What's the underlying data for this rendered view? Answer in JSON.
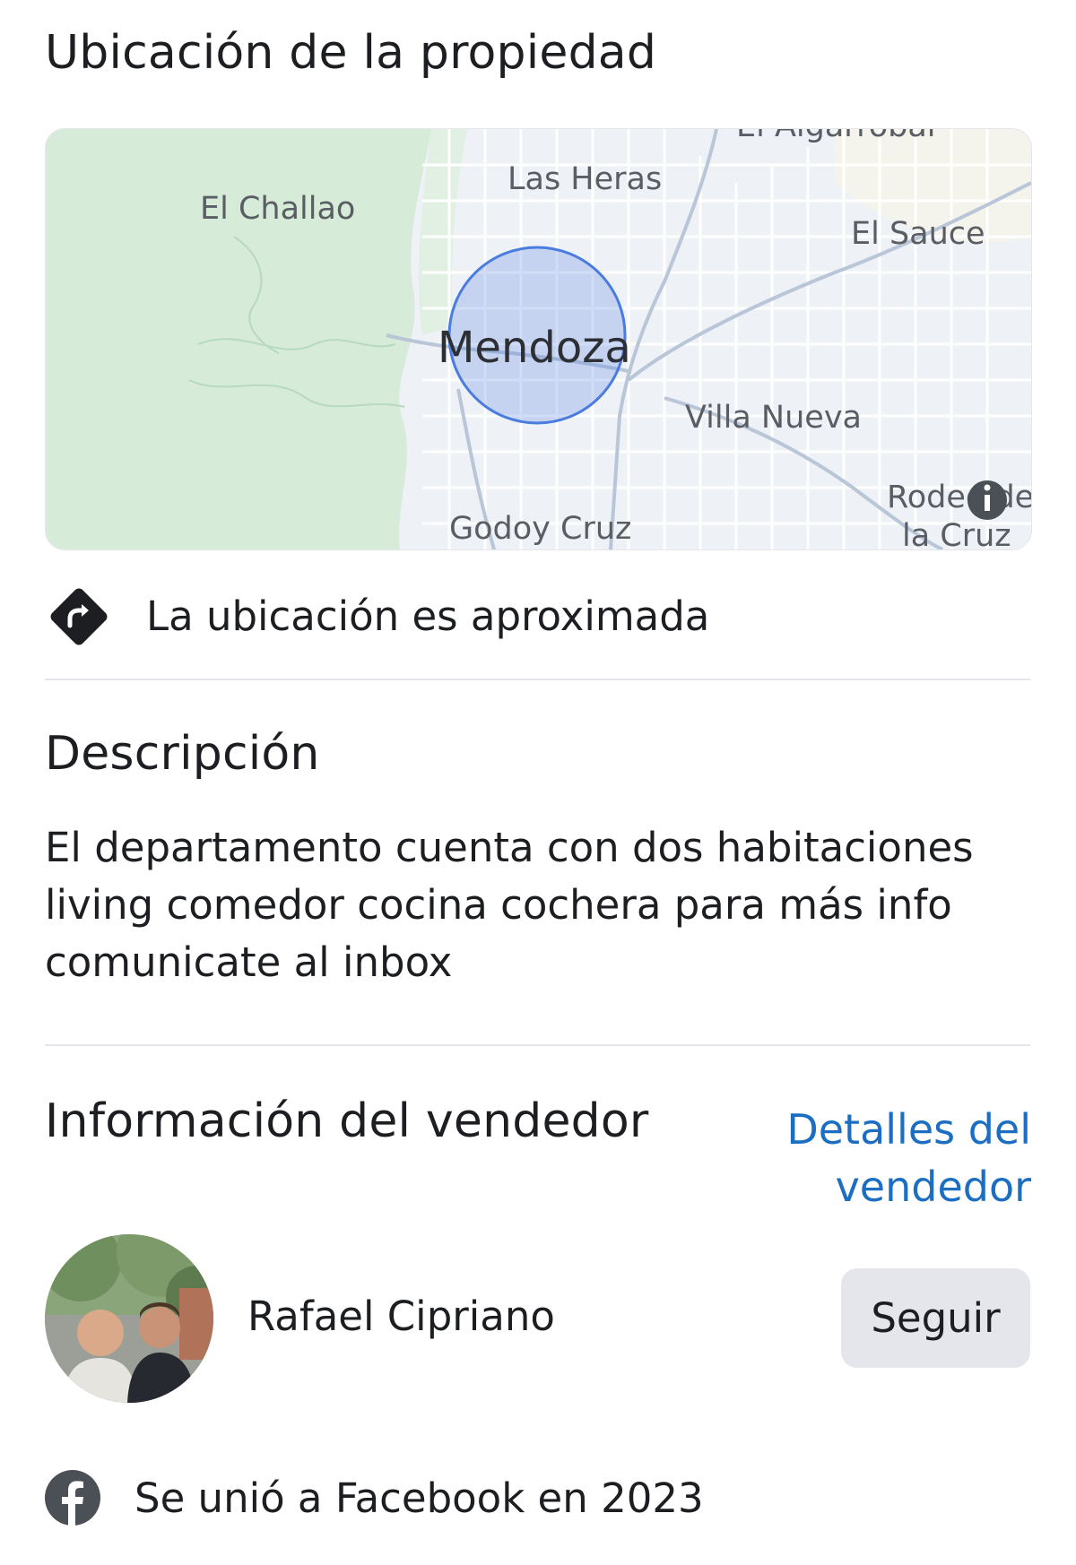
{
  "location": {
    "title": "Ubicación de la propiedad",
    "map_labels": {
      "top_cut": "El Algarrobal",
      "las_heras": "Las Heras",
      "el_challao": "El Challao",
      "el_sauce": "El Sauce",
      "mendoza": "Mendoza",
      "villa_nueva": "Villa Nueva",
      "rodeo_line1": "Rodeo de",
      "rodeo_line2": "la Cruz",
      "godoy_cruz": "Godoy Cruz"
    },
    "approx_note": "La ubicación es aproximada"
  },
  "description": {
    "title": "Descripción",
    "lines": [
      "El departamento cuenta con dos habitaciones",
      "living comedor cocina cochera para más info",
      "comunicate al inbox"
    ]
  },
  "seller": {
    "title": "Información del vendedor",
    "details_link_line1": "Detalles del",
    "details_link_line2": "vendedor",
    "name": "Rafael Cipriano",
    "follow_label": "Seguir",
    "joined_text": "Se unió a Facebook en 2023"
  },
  "icons": {
    "directions": "directions-icon",
    "info": "info-icon",
    "facebook": "facebook-icon"
  },
  "colors": {
    "link": "#1b6ec2",
    "map_circle": "#4a7ce0",
    "button_bg": "#e4e6eb"
  }
}
